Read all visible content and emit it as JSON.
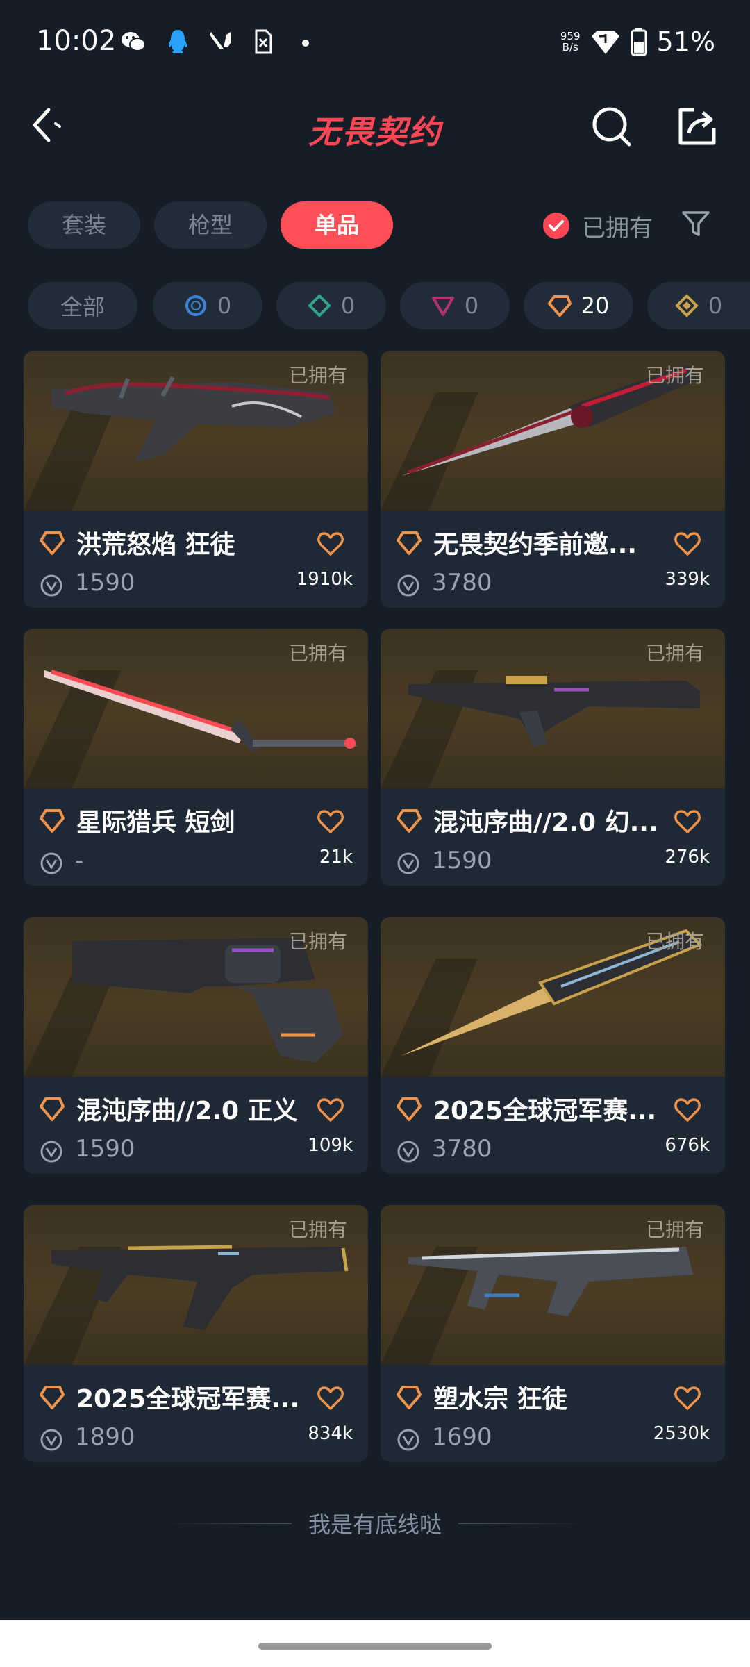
{
  "status_bar": {
    "time": "10:02",
    "net_speed_value": "959",
    "net_speed_unit": "B/s",
    "battery": "51%"
  },
  "header": {
    "title": "无畏契约"
  },
  "tabs": [
    "套装",
    "枪型",
    "单品"
  ],
  "owned_filter_label": "已拥有",
  "tiers": [
    {
      "label": "全部",
      "color": "#7c8794"
    },
    {
      "count": "0",
      "color": "#3a82d8"
    },
    {
      "count": "0",
      "color": "#2fa58a"
    },
    {
      "count": "0",
      "color": "#b0336b"
    },
    {
      "count": "20",
      "color": "#f0934c"
    },
    {
      "count": "0",
      "color": "#c9a24a"
    }
  ],
  "cards": [
    {
      "owned": "已拥有",
      "name": "洪荒怒焰 狂徒",
      "price": "1590",
      "likes": "1910k"
    },
    {
      "owned": "已拥有",
      "name": "无畏契约季前邀...",
      "price": "3780",
      "likes": "339k"
    },
    {
      "owned": "已拥有",
      "name": "星际猎兵 短剑",
      "price": "-",
      "likes": "21k"
    },
    {
      "owned": "已拥有",
      "name": "混沌序曲//2.0 幻...",
      "price": "1590",
      "likes": "276k"
    },
    {
      "owned": "已拥有",
      "name": "混沌序曲//2.0 正义",
      "price": "1590",
      "likes": "109k"
    },
    {
      "owned": "已拥有",
      "name": "2025全球冠军赛...",
      "price": "3780",
      "likes": "676k"
    },
    {
      "owned": "已拥有",
      "name": "2025全球冠军赛...",
      "price": "1890",
      "likes": "834k"
    },
    {
      "owned": "已拥有",
      "name": "塑水宗 狂徒",
      "price": "1690",
      "likes": "2530k"
    }
  ],
  "bottom_note": "我是有底线哒",
  "colors": {
    "accent": "#ff4655",
    "background": "#151d27",
    "card": "#1f2935",
    "tier_badge": "#f0934c"
  }
}
